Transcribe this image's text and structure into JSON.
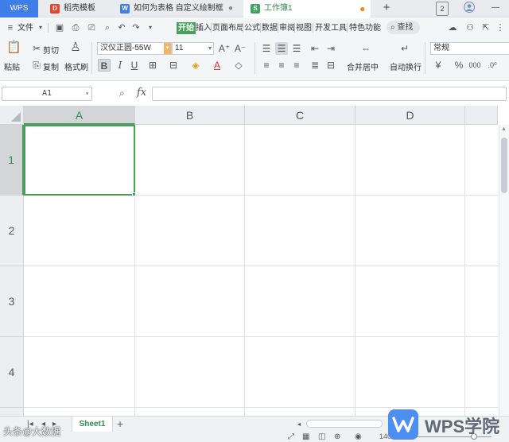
{
  "tabs": {
    "wps_label": "WPS",
    "items": [
      {
        "label": "稻壳模板",
        "icon": "daoke-icon"
      },
      {
        "label": "如何为表格 自定义绘制框",
        "icon": "word-doc-icon"
      },
      {
        "label": "工作簿1",
        "icon": "sheet-doc-icon"
      }
    ],
    "add_label": "+",
    "page_badge": "2",
    "minimize": "—"
  },
  "menu": {
    "file_label": "文件",
    "items": [
      "开始",
      "插入",
      "页面布局",
      "公式",
      "数据",
      "审阅",
      "视图",
      "开发工具",
      "特色功能"
    ],
    "search_label": "查找"
  },
  "ribbon": {
    "paste_label": "粘贴",
    "cut_label": "剪切",
    "copy_label": "复制",
    "format_painter_label": "格式刷",
    "font_name": "汉仪正圆-55W",
    "font_size": "11",
    "merge_label": "合并居中",
    "wrap_label": "自动换行",
    "number_format": "常规"
  },
  "formula_bar": {
    "cell_ref": "A1",
    "fx_label": "fx",
    "value": ""
  },
  "grid": {
    "columns": [
      "A",
      "B",
      "C",
      "D"
    ],
    "rows": [
      "1",
      "2",
      "3",
      "4"
    ],
    "selected_cell": "A1"
  },
  "sheets": {
    "items": [
      "Sheet1"
    ],
    "add_label": "+"
  },
  "status": {
    "zoom": "140%"
  },
  "watermark": {
    "left_text": "头条@大数据",
    "brand_text": "WPS学院"
  },
  "colors": {
    "accent_green": "#4aa05a",
    "wps_blue": "#3f7ee8",
    "brand_blue": "#4c8ef2"
  }
}
